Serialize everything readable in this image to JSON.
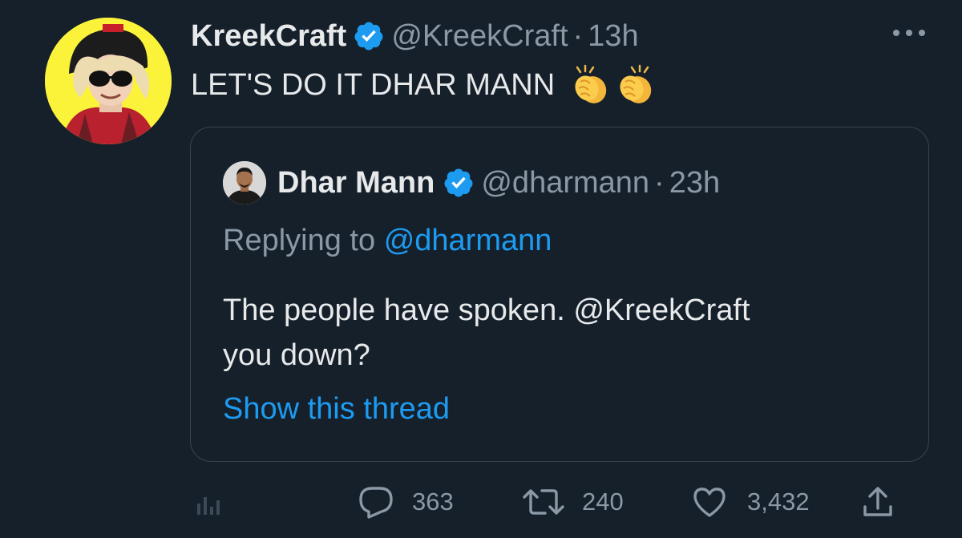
{
  "tweet": {
    "author": {
      "display_name": "KreekCraft",
      "handle": "@KreekCraft",
      "separator": "·",
      "time": "13h",
      "verified": true
    },
    "text": "LET'S DO IT DHAR MANN",
    "emojis": [
      "clap-emoji",
      "clap-emoji"
    ],
    "menu_icon": "more-horizontal-icon"
  },
  "quote": {
    "author": {
      "display_name": "Dhar Mann",
      "handle": "@dharmann",
      "separator": "·",
      "time": "23h",
      "verified": true
    },
    "replying_prefix": "Replying to",
    "replying_handle": "@dharmann",
    "text_before": "The people have spoken.",
    "text_mention": "@KreekCraft",
    "text_after": "you down?",
    "show_thread": "Show this thread"
  },
  "actions": {
    "analytics": {
      "icon": "analytics-icon"
    },
    "reply": {
      "icon": "reply-icon",
      "count": "363"
    },
    "retweet": {
      "icon": "retweet-icon",
      "count": "240"
    },
    "like": {
      "icon": "heart-icon",
      "count": "3,432"
    },
    "share": {
      "icon": "share-icon"
    }
  },
  "colors": {
    "background": "#15202b",
    "text": "#e7e9ea",
    "muted": "#8b98a5",
    "accent": "#1d9bf0",
    "border": "#38444d",
    "avatar_bg": "#fbf33a"
  }
}
